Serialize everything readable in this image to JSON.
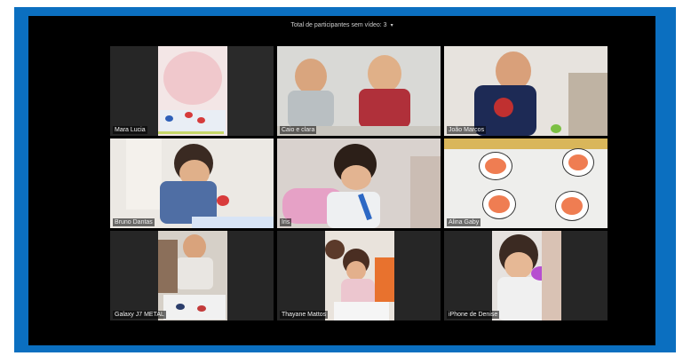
{
  "meeting": {
    "top_label": "Total de participantes sem vídeo: 3",
    "caret": "▾"
  },
  "participants": [
    {
      "name": "Mara Lucia",
      "active": false
    },
    {
      "name": "Caio e clara",
      "active": false
    },
    {
      "name": "João Marcos",
      "active": false
    },
    {
      "name": "Bruno Dantas",
      "active": false
    },
    {
      "name": "Iris",
      "active": false
    },
    {
      "name": "Alina Gaby",
      "active": false
    },
    {
      "name": "Galaxy J7 METAL",
      "active": true
    },
    {
      "name": "Thayane Mattos",
      "active": false
    },
    {
      "name": "iPhone de Denise",
      "active": false
    }
  ],
  "colors": {
    "frame": "#0b6fc0",
    "background": "#000000",
    "active_border": "#d9e27a"
  }
}
